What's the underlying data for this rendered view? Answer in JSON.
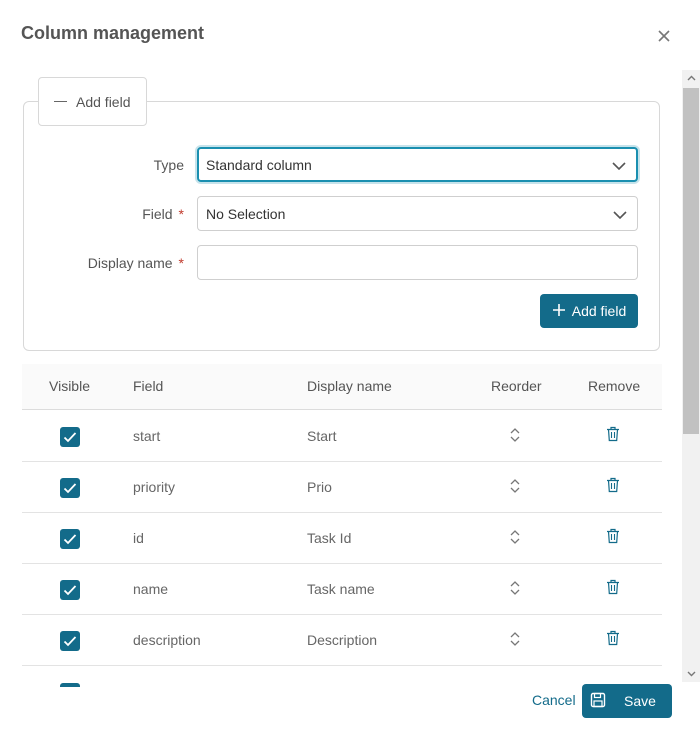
{
  "dialog": {
    "title": "Column management",
    "close_icon": "close-icon"
  },
  "add_field_section": {
    "legend_label": "Add field",
    "type": {
      "label": "Type",
      "value": "Standard column"
    },
    "field": {
      "label": "Field",
      "value": "No Selection",
      "required_mark": "*"
    },
    "display_name": {
      "label": "Display name",
      "value": "",
      "required_mark": "*"
    },
    "add_button_label": "Add field"
  },
  "table": {
    "headers": {
      "visible": "Visible",
      "field": "Field",
      "display_name": "Display name",
      "reorder": "Reorder",
      "remove": "Remove"
    },
    "rows": [
      {
        "field": "start",
        "display_name": "Start",
        "visible": true
      },
      {
        "field": "priority",
        "display_name": "Prio",
        "visible": true
      },
      {
        "field": "id",
        "display_name": "Task Id",
        "visible": true
      },
      {
        "field": "name",
        "display_name": "Task name",
        "visible": true
      },
      {
        "field": "description",
        "display_name": "Description",
        "visible": true
      }
    ]
  },
  "footer": {
    "cancel_label": "Cancel",
    "save_label": "Save"
  },
  "colors": {
    "accent": "#136b8a",
    "focus": "#1a8fb0",
    "required": "#c0392b"
  }
}
